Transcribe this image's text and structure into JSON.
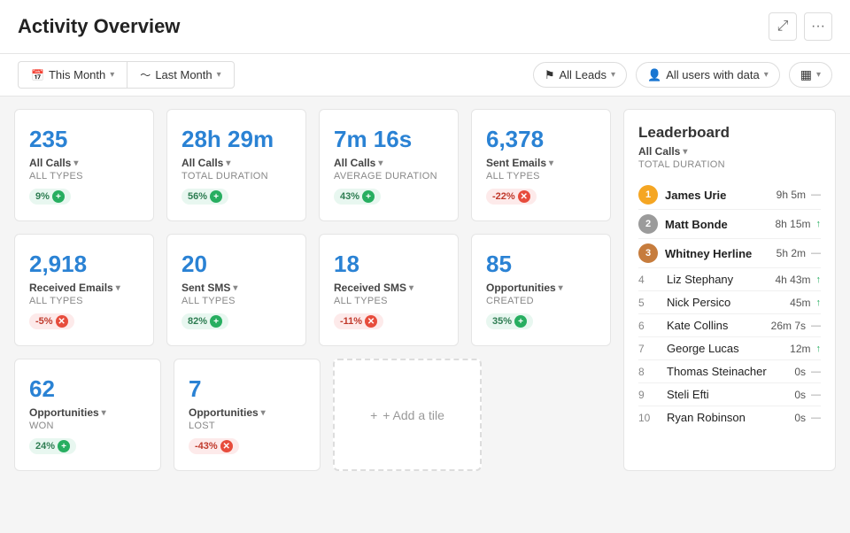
{
  "header": {
    "title": "Activity Overview",
    "expand_label": "⤢",
    "more_label": "···"
  },
  "filters": {
    "this_month": "This Month",
    "last_month": "Last Month",
    "leads": "All Leads",
    "users": "All users with data",
    "layout_icon": "▦"
  },
  "tiles": [
    {
      "value": "235",
      "label": "All Calls",
      "sub": "ALL TYPES",
      "badge": "9%",
      "badge_type": "green"
    },
    {
      "value": "28h 29m",
      "label": "All Calls",
      "sub": "TOTAL DURATION",
      "badge": "56%",
      "badge_type": "green"
    },
    {
      "value": "7m 16s",
      "label": "All Calls",
      "sub": "AVERAGE DURATION",
      "badge": "43%",
      "badge_type": "green"
    },
    {
      "value": "6,378",
      "label": "Sent Emails",
      "sub": "ALL TYPES",
      "badge": "-22%",
      "badge_type": "red"
    },
    {
      "value": "2,918",
      "label": "Received Emails",
      "sub": "ALL TYPES",
      "badge": "-5%",
      "badge_type": "red"
    },
    {
      "value": "20",
      "label": "Sent SMS",
      "sub": "ALL TYPES",
      "badge": "82%",
      "badge_type": "green"
    },
    {
      "value": "18",
      "label": "Received SMS",
      "sub": "ALL TYPES",
      "badge": "-11%",
      "badge_type": "red"
    },
    {
      "value": "85",
      "label": "Opportunities",
      "sub": "CREATED",
      "badge": "35%",
      "badge_type": "green"
    },
    {
      "value": "62",
      "label": "Opportunities",
      "sub": "WON",
      "badge": "24%",
      "badge_type": "green"
    },
    {
      "value": "7",
      "label": "Opportunities",
      "sub": "LOST",
      "badge": "-43%",
      "badge_type": "red"
    }
  ],
  "add_tile_label": "+ Add a tile",
  "leaderboard": {
    "title": "Leaderboard",
    "filter": "All Calls",
    "sub": "TOTAL DURATION",
    "rows": [
      {
        "rank": 1,
        "name": "James Urie",
        "value": "9h 5m",
        "trend": "—",
        "trend_type": "neutral"
      },
      {
        "rank": 2,
        "name": "Matt Bonde",
        "value": "8h 15m",
        "trend": "↑",
        "trend_type": "up"
      },
      {
        "rank": 3,
        "name": "Whitney Herline",
        "value": "5h 2m",
        "trend": "—",
        "trend_type": "neutral"
      },
      {
        "rank": 4,
        "name": "Liz Stephany",
        "value": "4h 43m",
        "trend": "↑",
        "trend_type": "up"
      },
      {
        "rank": 5,
        "name": "Nick Persico",
        "value": "45m",
        "trend": "↑",
        "trend_type": "up"
      },
      {
        "rank": 6,
        "name": "Kate Collins",
        "value": "26m 7s",
        "trend": "—",
        "trend_type": "neutral"
      },
      {
        "rank": 7,
        "name": "George Lucas",
        "value": "12m",
        "trend": "↑",
        "trend_type": "up"
      },
      {
        "rank": 8,
        "name": "Thomas Steinacher",
        "value": "0s",
        "trend": "—",
        "trend_type": "neutral"
      },
      {
        "rank": 9,
        "name": "Steli Efti",
        "value": "0s",
        "trend": "—",
        "trend_type": "neutral"
      },
      {
        "rank": 10,
        "name": "Ryan Robinson",
        "value": "0s",
        "trend": "—",
        "trend_type": "neutral"
      }
    ]
  }
}
